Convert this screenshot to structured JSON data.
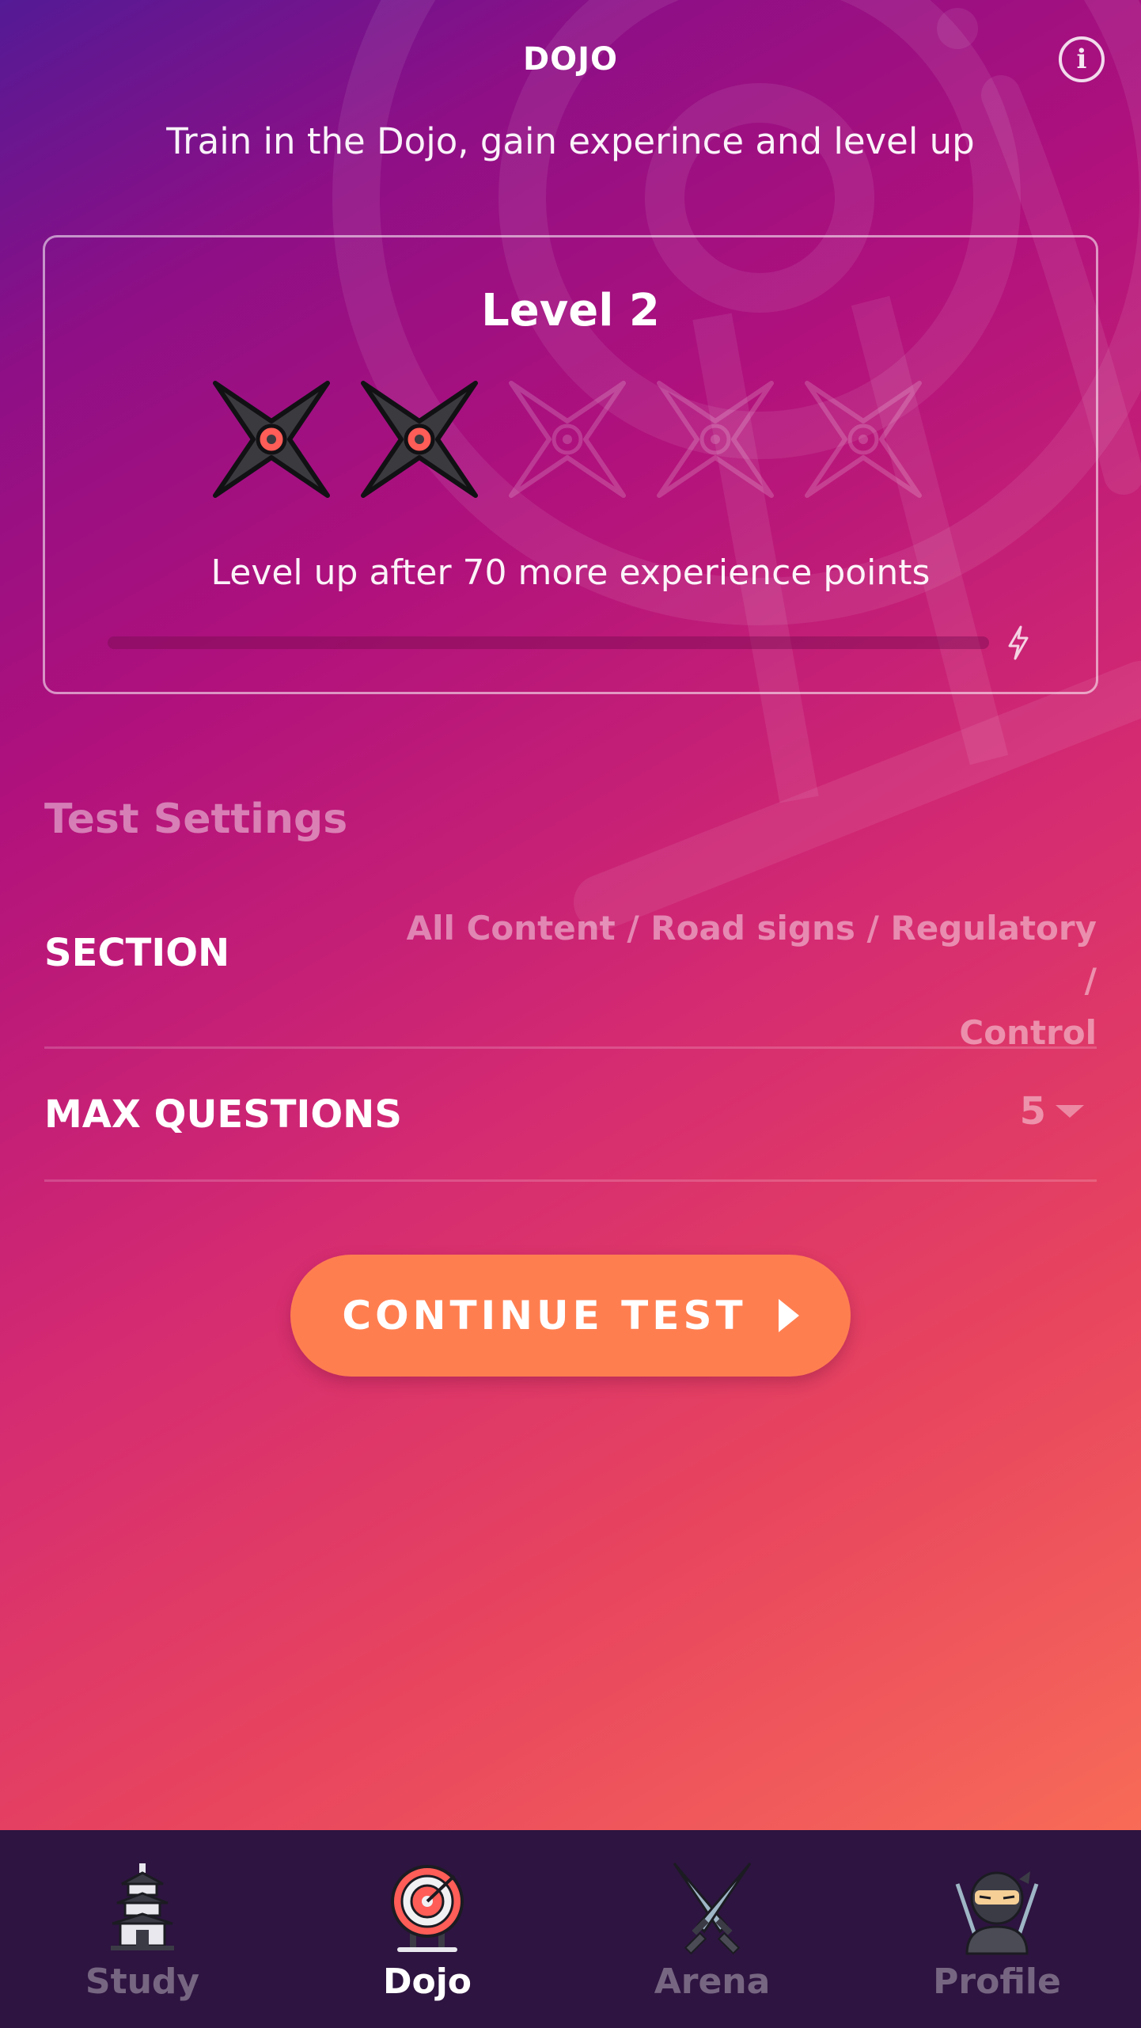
{
  "header": {
    "title": "DOJO",
    "subtitle": "Train in the Dojo, gain experince and level up",
    "info_icon": "info-icon",
    "info_glyph": "i"
  },
  "level_card": {
    "level_label": "Level 2",
    "stars_earned": 2,
    "stars_total": 5,
    "star_icon": "shuriken-icon",
    "message": "Level up after 70 more experience points",
    "progress": 0.0,
    "progress_icon": "lightning-bolt-icon"
  },
  "settings": {
    "title": "Test Settings",
    "section": {
      "label": "SECTION",
      "value_line1": "All Content / Road signs / Regulatory /",
      "value_line2": "Control"
    },
    "max_questions": {
      "label": "MAX QUESTIONS",
      "value": "5",
      "caret_icon": "dropdown-caret-icon"
    }
  },
  "continue_button": {
    "label": "CONTINUE TEST",
    "icon": "play-icon"
  },
  "tabs": [
    {
      "label": "Study",
      "icon": "pagoda-icon",
      "active": false
    },
    {
      "label": "Dojo",
      "icon": "target-icon",
      "active": true
    },
    {
      "label": "Arena",
      "icon": "crossed-swords-icon",
      "active": false
    },
    {
      "label": "Profile",
      "icon": "ninja-icon",
      "active": false
    }
  ],
  "colors": {
    "accent": "#ff7e50",
    "tabbar": "#2e1440",
    "shuriken_dark": "#3a3a3f",
    "shuriken_red": "#ff5d57"
  }
}
